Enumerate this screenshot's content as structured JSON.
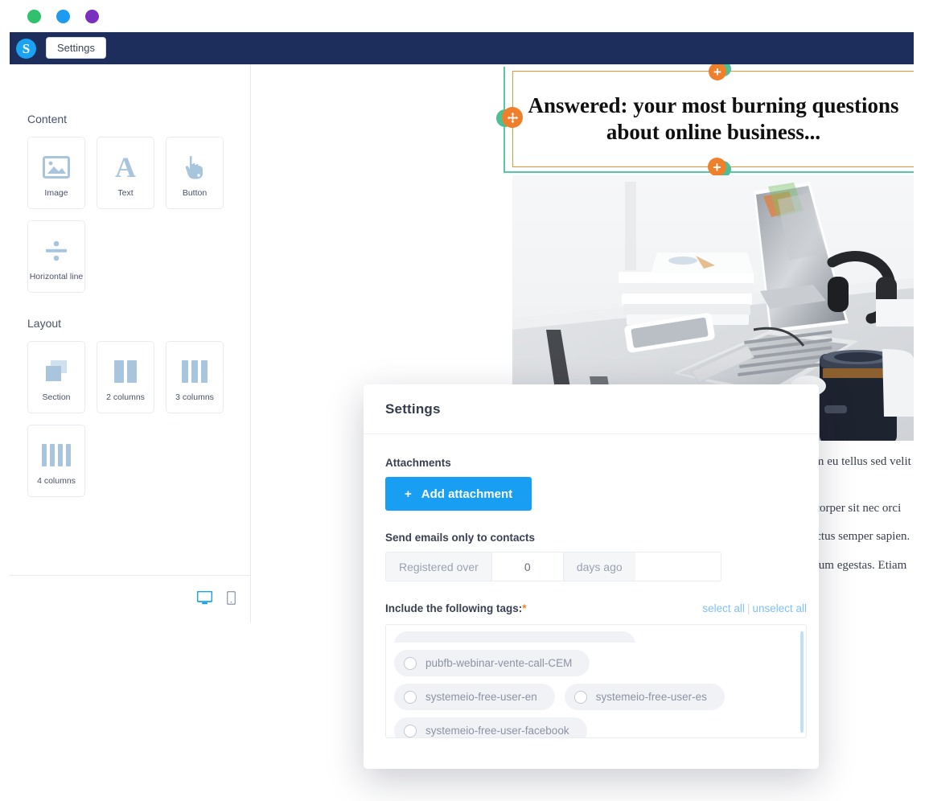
{
  "window": {
    "dots": [
      "green",
      "blue",
      "purple"
    ],
    "logo_letter": "S"
  },
  "topbar": {
    "settings_tab": "Settings"
  },
  "left_panel": {
    "sections": [
      {
        "title": "Content",
        "items": [
          {
            "label": "Image",
            "icon": "image-icon"
          },
          {
            "label": "Text",
            "icon": "text-icon"
          },
          {
            "label": "Button",
            "icon": "button-cursor-icon"
          },
          {
            "label": "Horizontal line",
            "icon": "divide-icon"
          }
        ]
      },
      {
        "title": "Layout",
        "items": [
          {
            "label": "Section",
            "icon": "section-icon"
          },
          {
            "label": "2 columns",
            "icon": "two-columns-icon"
          },
          {
            "label": "3 columns",
            "icon": "three-columns-icon"
          },
          {
            "label": "4 columns",
            "icon": "four-columns-icon"
          }
        ]
      }
    ],
    "footer": {
      "desktop_icon": "desktop-icon",
      "mobile_icon": "mobile-icon",
      "active_view": "desktop"
    }
  },
  "canvas": {
    "selected_block": {
      "headline": "Answered: your most burning questions about online business...",
      "border_color": "#f2922f",
      "hover_color": "#4cbf95",
      "controls": [
        {
          "name": "settings-gear",
          "icon": "gear-icon"
        },
        {
          "name": "duplicate",
          "icon": "copy-icon"
        },
        {
          "name": "delete",
          "icon": "trash-icon"
        }
      ],
      "move_handle": "move-icon",
      "add_above": "plus-icon",
      "add_below": "plus-icon"
    },
    "image_block": {
      "alt": "desk with laptop books smartphone headphones and coffee mug"
    },
    "body_paragraphs": [
      "Lorem ipsum dolor sit amet, consectetur adipiscing elit. Nullam eu tellus sed velit vitae",
      "consequat pulvinar. Praesent eu nulla at erat tincidunt ullamcorper sit nec orci",
      "Fusce quis lorem vitae nisi tempor gravida. Donec vehicula lectus semper sapien.",
      "Curabitur porttitor massa id justo elementum, vitae lacinia ipsum egestas. Etiam"
    ]
  },
  "modal": {
    "title": "Settings",
    "attachments": {
      "label": "Attachments",
      "add_button": "Add attachment",
      "add_button_prefix": "+",
      "accent_color": "#189ef2"
    },
    "send_filter": {
      "label": "Send emails only to contacts",
      "prefix": "Registered over",
      "value": "0",
      "suffix": "days ago"
    },
    "tags": {
      "label": "Include the following tags:",
      "required_mark": "*",
      "select_all": "select all",
      "separator": "|",
      "unselect_all": "unselect all",
      "items": [
        {
          "name": "pubfb-webinar-vente-call-CEM",
          "selected": false
        },
        {
          "name": "systemeio-free-user-en",
          "selected": false
        },
        {
          "name": "systemeio-free-user-es",
          "selected": false
        },
        {
          "name": "systemeio-free-user-facebook",
          "selected": false
        }
      ]
    }
  }
}
